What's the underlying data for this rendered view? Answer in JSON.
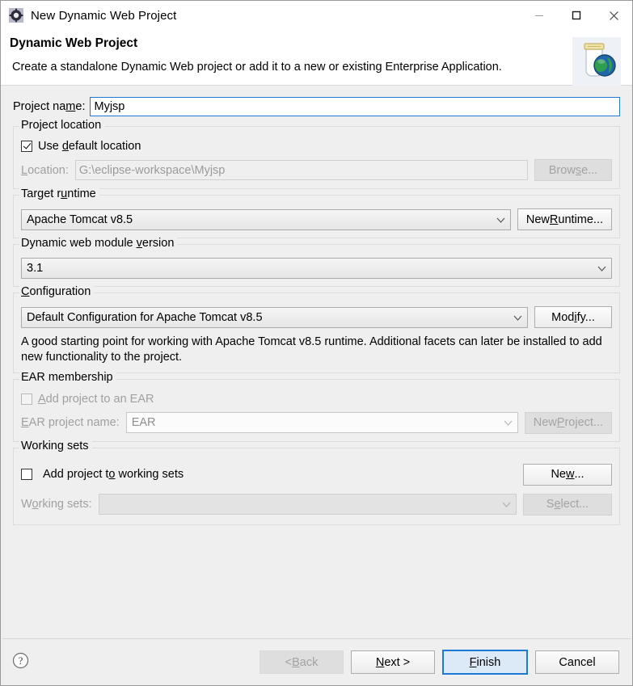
{
  "window": {
    "title": "New Dynamic Web Project",
    "icon": "eclipse-gear-icon",
    "minimize_label": "Minimize",
    "maximize_label": "Maximize",
    "close_label": "Close"
  },
  "header": {
    "title": "Dynamic Web Project",
    "description": "Create a standalone Dynamic Web project or add it to a new or existing Enterprise Application.",
    "icon": "jar-globe-icon"
  },
  "form": {
    "project_name_label_pre": "Project na",
    "project_name_label_mnemonic": "m",
    "project_name_label_post": "e:",
    "project_name_value": "Myjsp",
    "project_location_group": "Project location",
    "use_default_location_pre": "Use ",
    "use_default_location_mnemonic": "d",
    "use_default_location_post": "efault location",
    "use_default_location_checked": true,
    "location_label_mnemonic": "L",
    "location_label_post": "ocation:",
    "location_value": "G:\\eclipse-workspace\\Myjsp",
    "browse_button_pre": "Brow",
    "browse_button_mnemonic": "s",
    "browse_button_post": "e...",
    "target_runtime_group_pre": "Target r",
    "target_runtime_group_mnemonic": "u",
    "target_runtime_group_post": "ntime",
    "target_runtime_value": "Apache Tomcat v8.5",
    "new_runtime_button_pre": "New ",
    "new_runtime_button_mnemonic": "R",
    "new_runtime_button_post": "untime...",
    "module_version_group_pre": "Dynamic web module ",
    "module_version_group_mnemonic": "v",
    "module_version_group_post": "ersion",
    "module_version_value": "3.1",
    "configuration_group_mnemonic": "C",
    "configuration_group_post": "onfiguration",
    "configuration_value": "Default Configuration for Apache Tomcat v8.5",
    "modify_button_pre": "Mod",
    "modify_button_mnemonic": "i",
    "modify_button_post": "fy...",
    "configuration_description": "A good starting point for working with Apache Tomcat v8.5 runtime. Additional facets can later be installed to add new functionality to the project.",
    "ear_membership_group": "EAR membership",
    "add_to_ear_mnemonic": "A",
    "add_to_ear_post": "dd project to an EAR",
    "add_to_ear_checked": false,
    "ear_project_name_mnemonic": "E",
    "ear_project_name_post": "AR project name:",
    "ear_project_name_value": "EAR",
    "new_project_button_pre": "New ",
    "new_project_button_mnemonic": "P",
    "new_project_button_post": "roject...",
    "working_sets_group": "Working sets",
    "add_to_working_sets_pre": "Add project t",
    "add_to_working_sets_mnemonic": "o",
    "add_to_working_sets_post": " working sets",
    "add_to_working_sets_checked": false,
    "new_workingset_button_pre": "Ne",
    "new_workingset_button_mnemonic": "w",
    "new_workingset_button_post": "...",
    "working_sets_label_pre": "W",
    "working_sets_label_mnemonic": "o",
    "working_sets_label_post": "rking sets:",
    "working_sets_value": "",
    "select_button_pre": "S",
    "select_button_mnemonic": "e",
    "select_button_post": "lect..."
  },
  "footer": {
    "help_icon": "help-question-icon",
    "back_pre": "< ",
    "back_mnemonic": "B",
    "back_post": "ack",
    "next_mnemonic": "N",
    "next_post": "ext >",
    "finish_pre": "",
    "finish_mnemonic": "F",
    "finish_post": "inish",
    "cancel_label": "Cancel"
  },
  "colors": {
    "accent": "#1c7ad4",
    "dialog_bg": "#efefef",
    "header_bg": "#ffffff",
    "disabled_text": "#a0a0a0"
  }
}
